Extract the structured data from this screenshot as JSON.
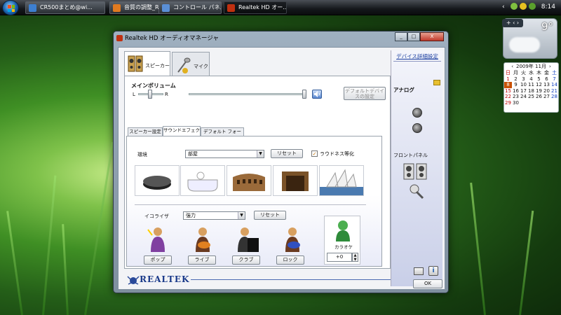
{
  "taskbar": {
    "items": [
      {
        "label": "CR500まとめ@wi...",
        "color": "#3d7fd1"
      },
      {
        "label": "音質の調整_Realte...",
        "color": "#e07a20"
      },
      {
        "label": "コントロール パネル",
        "color": "#5a8fd6"
      },
      {
        "label": "Realtek HD オー...",
        "color": "#c03010"
      }
    ],
    "clock": "8:14"
  },
  "weather": {
    "temp": "9°",
    "controls": "+ ‹ ›"
  },
  "calendar": {
    "header": "2009年 11月",
    "days": [
      "日",
      "月",
      "火",
      "水",
      "木",
      "金",
      "土"
    ],
    "dates": [
      "1",
      "2",
      "3",
      "4",
      "5",
      "6",
      "7",
      "8",
      "9",
      "10",
      "11",
      "12",
      "13",
      "14",
      "15",
      "16",
      "17",
      "18",
      "19",
      "20",
      "21",
      "22",
      "23",
      "24",
      "25",
      "26",
      "27",
      "28",
      "29",
      "30"
    ],
    "today": "8"
  },
  "window": {
    "title": "Realtek HD オーディオマネージャ",
    "buttons": {
      "min": "_",
      "max": "□",
      "close": "X"
    },
    "tabs": {
      "speaker": "スピーカー",
      "mic": "マイク"
    },
    "main_volume": {
      "label": "メインボリューム",
      "l": "L",
      "r": "R",
      "balance": 0.5,
      "level": 1.0
    },
    "default_device_button": "デフォルトデバイスの設定",
    "inner_tabs": [
      "スピーカー設定",
      "サウンドエフェクト",
      "デフォルト フォーマット"
    ],
    "environment": {
      "label": "環境",
      "value": "部屋",
      "reset": "リセット",
      "loudness": "ラウドネス等化",
      "loudness_checked": true
    },
    "environment_presets": [
      "stone",
      "bathtub",
      "colosseum",
      "stage",
      "opera-house"
    ],
    "equalizer": {
      "label": "イコライザ",
      "value": "強力",
      "reset": "リセット",
      "presets": [
        "ポップ",
        "ライブ",
        "クラブ",
        "ロック"
      ]
    },
    "karaoke": {
      "label": "カラオケ",
      "value": "+0"
    },
    "right_panel": {
      "link": "デバイス詳細設定",
      "analog": "アナログ",
      "front_panel": "フロントパネル"
    },
    "brand": "REALTEK",
    "ok": "OK"
  }
}
